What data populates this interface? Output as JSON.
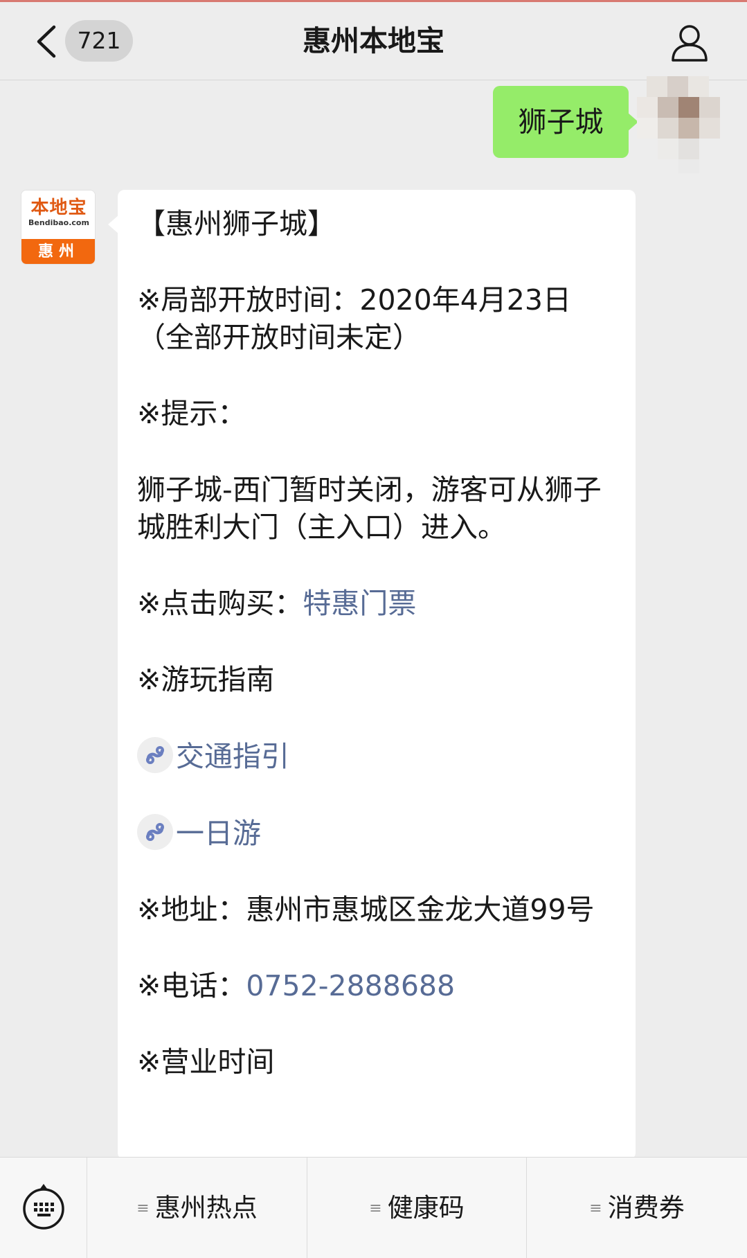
{
  "header": {
    "back_count": "721",
    "title": "惠州本地宝"
  },
  "user_message": {
    "text": "狮子城"
  },
  "bot": {
    "avatar_brand": "本地宝",
    "avatar_domain": "Bendibao.com",
    "avatar_city": "惠州"
  },
  "article": {
    "title": "【惠州狮子城】",
    "open_time": "※局部开放时间：2020年4月23日（全部开放时间未定）",
    "tip_label": "※提示：",
    "tip_text": "狮子城-西门暂时关闭，游客可从狮子城胜利大门（主入口）进入。",
    "buy_label": "※点击购买：",
    "buy_link": "特惠门票",
    "guide_label": "※游玩指南",
    "guide_link_1": "交通指引",
    "guide_link_2": "一日游",
    "address": "※地址：惠州市惠城区金龙大道99号",
    "phone_label": "※电话：",
    "phone_number": "0752-2888688",
    "hours_label": "※营业时间"
  },
  "bottom_menu": {
    "item_1": "惠州热点",
    "item_2": "健康码",
    "item_3": "消费券"
  },
  "colors": {
    "user_bubble": "#95ec69",
    "link": "#576b95",
    "brand_orange": "#f2680f"
  },
  "icons": [
    "back-chevron-icon",
    "profile-icon",
    "mini-program-icon",
    "keyboard-icon",
    "menu-lines-icon"
  ]
}
